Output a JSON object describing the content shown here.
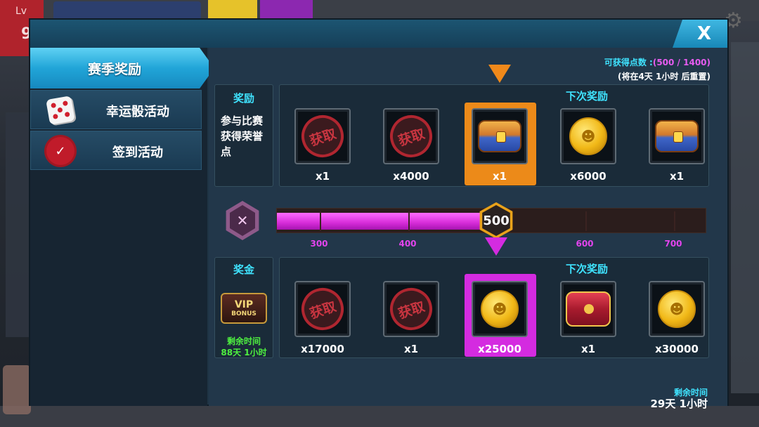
{
  "background": {
    "level_label": "Lv",
    "level_value": "9"
  },
  "dialog": {
    "close_label": "X"
  },
  "tabs": [
    {
      "label": "赛季奖励",
      "icon": "none",
      "active": true
    },
    {
      "label": "幸运骰活动",
      "icon": "dice-icon",
      "active": false
    },
    {
      "label": "签到活动",
      "icon": "seal-icon",
      "active": false
    }
  ],
  "points": {
    "label": "可获得点数 :",
    "value": "(500 / 1400)",
    "reset": "(将在4天 1小时 后重置)"
  },
  "reward_section": {
    "title": "奖励",
    "desc_lines": [
      "参与比赛",
      "获得荣誉",
      "点"
    ],
    "next_label": "下次奖励",
    "items": [
      {
        "icon": "claimed-stamp",
        "stamp": "获取",
        "qty": "x1"
      },
      {
        "icon": "claimed-stamp",
        "stamp": "获取",
        "qty": "x4000"
      },
      {
        "icon": "chest-icon",
        "qty": "x1",
        "highlight": "orange"
      },
      {
        "icon": "coin-icon",
        "qty": "x6000"
      },
      {
        "icon": "chest-icon",
        "qty": "x1"
      }
    ]
  },
  "progress": {
    "current": 500,
    "max": 700,
    "min": 200,
    "badge": "500",
    "ticks": [
      "300",
      "400",
      "500",
      "600",
      "700"
    ],
    "tick_values": [
      300,
      400,
      500,
      600,
      700
    ]
  },
  "bonus_section": {
    "title": "奖金",
    "vip_line1": "VIP",
    "vip_line2": "BONUS",
    "remain_label": "剩余时间",
    "remain_value": "88天 1小时",
    "next_label": "下次奖励",
    "items": [
      {
        "icon": "claimed-stamp",
        "stamp": "获取",
        "qty": "x17000"
      },
      {
        "icon": "claimed-stamp",
        "stamp": "获取",
        "qty": "x1"
      },
      {
        "icon": "coin-icon",
        "qty": "x25000",
        "highlight": "purple"
      },
      {
        "icon": "red-chest-icon",
        "qty": "x1"
      },
      {
        "icon": "coin-icon",
        "qty": "x30000"
      }
    ]
  },
  "season_remaining": {
    "label": "剩余时间",
    "value": "29天 1小时"
  },
  "colors": {
    "accent_cyan": "#3fe3ff",
    "progress_magenta": "#d62cd8",
    "highlight_orange": "#ec8a19",
    "highlight_purple": "#d42be0",
    "remain_green": "#4ef040"
  }
}
